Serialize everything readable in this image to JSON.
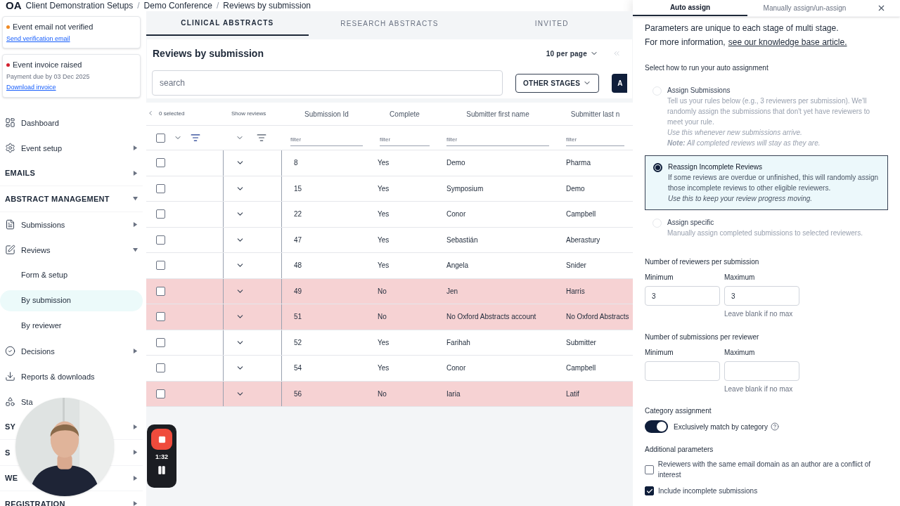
{
  "header": {
    "logo": "OA",
    "breadcrumb": [
      {
        "kind": "link",
        "text": "Client Demonstration Setups"
      },
      {
        "kind": "separator",
        "text": "/"
      },
      {
        "kind": "link",
        "text": "Demo Conference"
      },
      {
        "kind": "separator",
        "text": "/"
      },
      {
        "kind": "link",
        "text": "Reviews by submission"
      }
    ]
  },
  "notices": [
    {
      "title": "Event email not verified",
      "color": "#f08a24",
      "link": "Send verification email"
    },
    {
      "title": "Event invoice raised",
      "color": "#d3202f",
      "detail": "Payment due by 03 Dec 2025",
      "link": "Download invoice"
    }
  ],
  "nav": [
    {
      "kind": "item",
      "label": "Dashboard"
    },
    {
      "kind": "item",
      "label": "Event setup",
      "expanded": false
    },
    {
      "kind": "section",
      "label": "EMAILS",
      "expanded": false
    },
    {
      "kind": "section",
      "label": "ABSTRACT MANAGEMENT",
      "expanded": true
    },
    {
      "kind": "item",
      "label": "Submissions",
      "expanded": false
    },
    {
      "kind": "item",
      "label": "Reviews",
      "expanded": true
    },
    {
      "kind": "subitem",
      "label": "Form & setup",
      "selected": false
    },
    {
      "kind": "subitem",
      "label": "By submission",
      "selected": true
    },
    {
      "kind": "subitem",
      "label": "By reviewer",
      "selected": false
    },
    {
      "kind": "item",
      "label": "Decisions",
      "expanded": false
    },
    {
      "kind": "item",
      "label": "Reports & downloads"
    },
    {
      "kind": "item",
      "label": "Sta"
    },
    {
      "kind": "section",
      "label": "SY",
      "expanded": false
    },
    {
      "kind": "section",
      "label": "S",
      "expanded": false
    },
    {
      "kind": "section",
      "label": "WE",
      "expanded": false
    },
    {
      "kind": "section",
      "label": "REGISTRATION",
      "expanded": false
    }
  ],
  "recorder": {
    "time": "1:32"
  },
  "tabs": [
    {
      "label": "CLINICAL ABSTRACTS",
      "selected": true
    },
    {
      "label": "RESEARCH ABSTRACTS",
      "selected": false
    },
    {
      "label": "INVITED",
      "selected": false
    }
  ],
  "title": "Reviews by submission",
  "per_page": "10 per page",
  "search": {
    "placeholder": "search"
  },
  "stages_button": "OTHER STAGES",
  "action_button": "A",
  "table": {
    "selected_count": "0 selected",
    "show_reviews": "Show reviews",
    "columns": [
      "Submission Id",
      "Complete",
      "Submitter first name",
      "Submitter last n"
    ],
    "filter_placeholders": [
      "filter",
      "filter",
      "filter",
      "filter"
    ],
    "all_checked": false,
    "rows": [
      {
        "id": "8",
        "complete": "Yes",
        "done": true,
        "first": "Demo",
        "last": "Pharma",
        "checked": false
      },
      {
        "id": "15",
        "complete": "Yes",
        "done": true,
        "first": "Symposium",
        "last": "Demo",
        "checked": false
      },
      {
        "id": "22",
        "complete": "Yes",
        "done": true,
        "first": "Conor",
        "last": "Campbell",
        "checked": false
      },
      {
        "id": "47",
        "complete": "Yes",
        "done": true,
        "first": "Sebastián",
        "last": "Aberastury",
        "checked": false
      },
      {
        "id": "48",
        "complete": "Yes",
        "done": true,
        "first": "Angela",
        "last": "Snider",
        "checked": false
      },
      {
        "id": "49",
        "complete": "No",
        "done": false,
        "first": "Jen",
        "last": "Harris",
        "checked": false
      },
      {
        "id": "51",
        "complete": "No",
        "done": false,
        "first": "No Oxford Abstracts account",
        "last": "No Oxford Abstracts",
        "checked": false
      },
      {
        "id": "52",
        "complete": "Yes",
        "done": true,
        "first": "Farihah",
        "last": "Submitter",
        "checked": false
      },
      {
        "id": "54",
        "complete": "Yes",
        "done": true,
        "first": "Conor",
        "last": "Campbell",
        "checked": false
      },
      {
        "id": "56",
        "complete": "No",
        "done": false,
        "first": "Iaria",
        "last": "Latif",
        "checked": false
      }
    ]
  },
  "panel": {
    "tabs": [
      {
        "label": "Auto assign",
        "selected": true
      },
      {
        "label": "Manually assign/un-assign",
        "selected": false
      }
    ],
    "intro": "Parameters are unique to each stage of multi stage.",
    "more": "For more information,",
    "more_link": "see our knowledge base article.",
    "mode_label": "Select how to run your auto assignment",
    "options": [
      {
        "title": "Assign Submissions",
        "selected": false,
        "text": "Tell us your rules below (e.g., 3 reviewers per submission). We'll randomly assign the submissions that don't yet have reviewers to meet your rule.",
        "notes": [
          "Use this whenever new submissions arrive.",
          "**Note:** All completed reviews will stay as they are."
        ]
      },
      {
        "title": "Reassign Incomplete Reviews",
        "selected": true,
        "text": "If some reviews are overdue or unfinished, this will randomly assign those incomplete reviews to other eligible reviewers.",
        "notes": [
          "Use this to keep your review progress moving."
        ]
      },
      {
        "title": "Assign specific",
        "selected": false,
        "text": "Manually assign completed submissions to selected reviewers."
      }
    ],
    "groups": [
      {
        "label": "Number of reviewers per submission",
        "fields": [
          {
            "label": "Minimum",
            "value": "3"
          },
          {
            "label": "Maximum",
            "value": "3",
            "hint": "Leave blank if no max"
          }
        ]
      },
      {
        "label": "Number of submissions per reviewer",
        "fields": [
          {
            "label": "Minimum"
          },
          {
            "label": "Maximum",
            "hint": "Leave blank if no max"
          }
        ]
      }
    ],
    "category": {
      "label": "Category assignment",
      "toggle": "Exclusively match by category",
      "on": true
    },
    "additional": {
      "label": "Additional parameters",
      "items": [
        {
          "label": "Reviewers with the same email domain as an author are a conflict of interest",
          "checked": false
        },
        {
          "label": "Include incomplete submissions",
          "checked": true
        }
      ]
    }
  }
}
